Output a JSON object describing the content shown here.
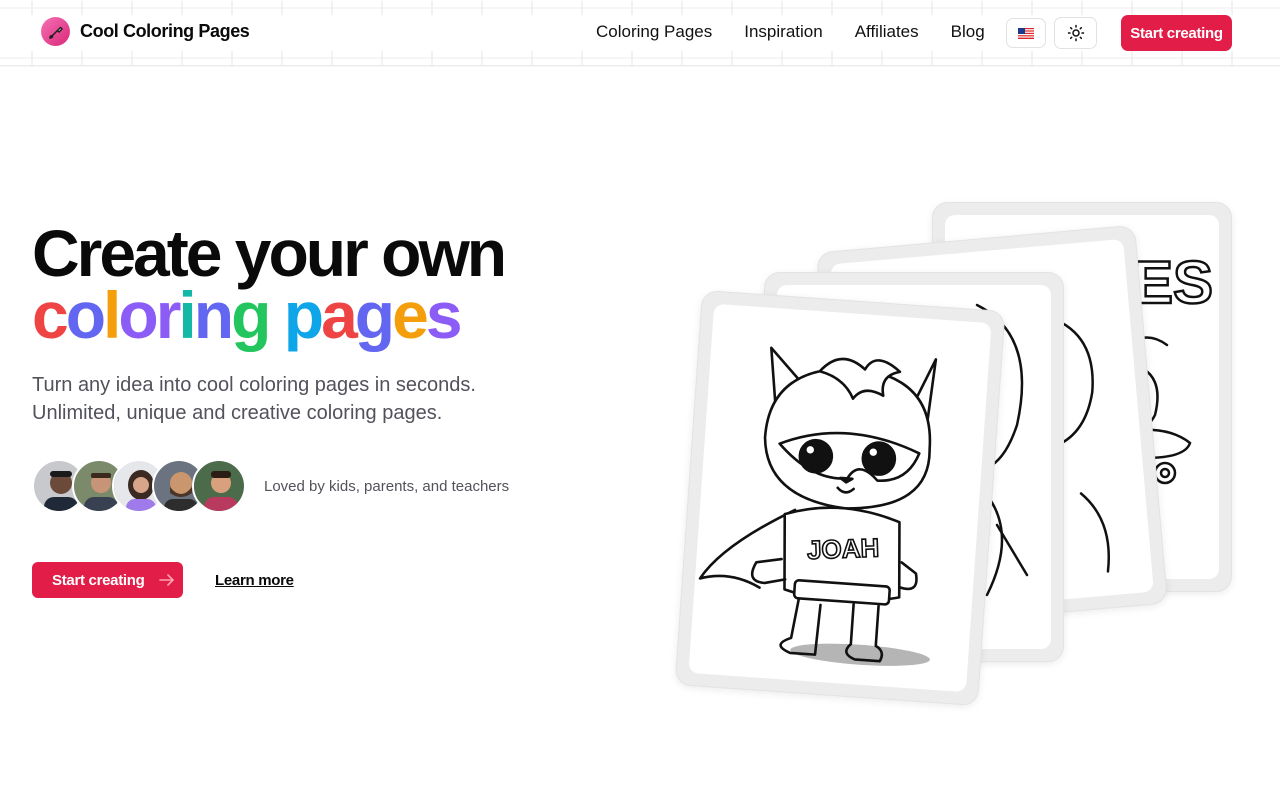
{
  "brand": {
    "name": "Cool Coloring Pages",
    "logo_icon": "paintbrush-icon"
  },
  "nav": {
    "items": [
      {
        "label": "Coloring Pages"
      },
      {
        "label": "Inspiration"
      },
      {
        "label": "Affiliates"
      },
      {
        "label": "Blog"
      }
    ],
    "language_icon": "us-flag-icon",
    "theme_icon": "sun-icon",
    "cta_label": "Start creating"
  },
  "hero": {
    "title_line1": "Create your own",
    "title_line2_letters": [
      {
        "ch": "c",
        "color": "#ef4444"
      },
      {
        "ch": "o",
        "color": "#6366f1"
      },
      {
        "ch": "l",
        "color": "#f59e0b"
      },
      {
        "ch": "o",
        "color": "#8b5cf6"
      },
      {
        "ch": "r",
        "color": "#8b5cf6"
      },
      {
        "ch": "i",
        "color": "#14b8a6"
      },
      {
        "ch": "n",
        "color": "#6366f1"
      },
      {
        "ch": "g",
        "color": "#22c55e"
      },
      {
        "ch": " ",
        "color": "#000000"
      },
      {
        "ch": "p",
        "color": "#0ea5e9"
      },
      {
        "ch": "a",
        "color": "#ef4444"
      },
      {
        "ch": "g",
        "color": "#6366f1"
      },
      {
        "ch": "e",
        "color": "#f59e0b"
      },
      {
        "ch": "s",
        "color": "#8b5cf6"
      }
    ],
    "subtitle": "Turn any idea into cool coloring pages in seconds. Unlimited, unique and creative coloring pages.",
    "social_proof": "Loved by kids, parents, and teachers",
    "cta_label": "Start creating",
    "cta_icon": "arrow-right-icon",
    "secondary_label": "Learn more"
  },
  "colors": {
    "accent": "#e11d48",
    "text_muted": "#52525b"
  },
  "preview_cards": {
    "back_card_text": "ES",
    "front_card_name": "JOAH"
  }
}
